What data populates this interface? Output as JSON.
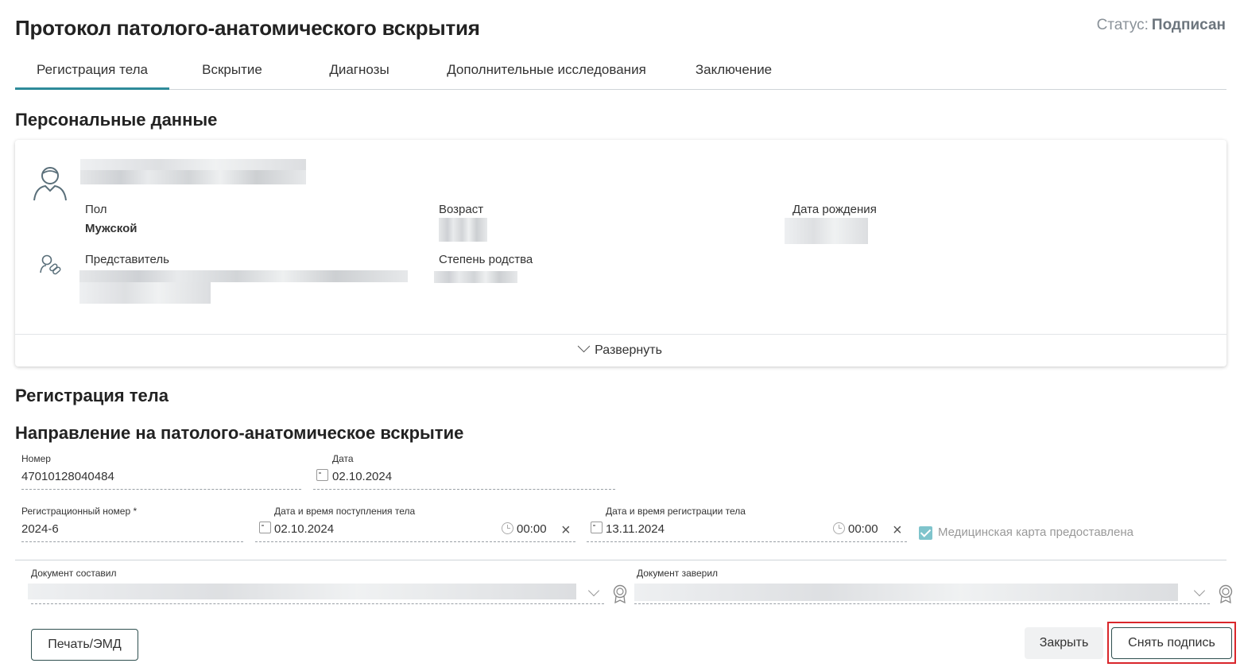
{
  "header": {
    "title": "Протокол патолого-анатомического вскрытия",
    "status_label": "Статус:",
    "status_value": "Подписан"
  },
  "tabs": [
    {
      "label": "Регистрация тела",
      "active": true
    },
    {
      "label": "Вскрытие",
      "active": false
    },
    {
      "label": "Диагнозы",
      "active": false
    },
    {
      "label": "Дополнительные исследования",
      "active": false
    },
    {
      "label": "Заключение",
      "active": false
    }
  ],
  "personal": {
    "section_title": "Персональные данные",
    "gender_label": "Пол",
    "gender_value": "Мужской",
    "age_label": "Возраст",
    "birthdate_label": "Дата рождения",
    "representative_label": "Представитель",
    "relation_label": "Степень родства",
    "expand_label": "Развернуть",
    "icons": [
      "person-icon",
      "representative-icon"
    ]
  },
  "registration": {
    "section_title": "Регистрация тела",
    "referral_title": "Направление на патолого-анатомическое вскрытие",
    "number_label": "Номер",
    "number_value": "47010128040484",
    "date_label": "Дата",
    "date_value": "02.10.2024",
    "reg_number_label": "Регистрационный номер *",
    "reg_number_value": "2024-6",
    "arrival_label": "Дата и время поступления тела",
    "arrival_date": "02.10.2024",
    "arrival_time": "00:00",
    "reg_datetime_label": "Дата и время регистрации тела",
    "reg_date": "13.11.2024",
    "reg_time": "00:00",
    "medcard_label": "Медицинская карта предоставлена",
    "medcard_checked": true
  },
  "signers": {
    "composed_label": "Документ составил",
    "certified_label": "Документ заверил"
  },
  "footer": {
    "print_label": "Печать/ЭМД",
    "close_label": "Закрыть",
    "unsign_label": "Снять подпись"
  },
  "colors": {
    "accent": "#2e8b9a",
    "checkbox": "#7fc4cc",
    "highlight": "#d9262b"
  }
}
